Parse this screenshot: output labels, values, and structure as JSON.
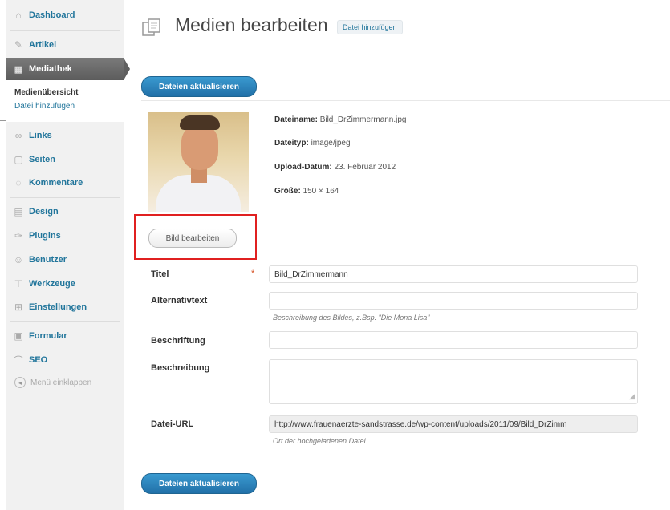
{
  "sidebar": {
    "items": [
      {
        "label": "Dashboard",
        "icon": "dashboard-icon",
        "glyph": "⌂"
      },
      {
        "label": "Artikel",
        "icon": "pin-icon",
        "glyph": "✎"
      },
      {
        "label": "Mediathek",
        "icon": "media-icon",
        "glyph": "▦"
      },
      {
        "label": "Links",
        "icon": "link-icon",
        "glyph": "∞"
      },
      {
        "label": "Seiten",
        "icon": "page-icon",
        "glyph": "▢"
      },
      {
        "label": "Kommentare",
        "icon": "comment-icon",
        "glyph": "◌"
      },
      {
        "label": "Design",
        "icon": "design-icon",
        "glyph": "▤"
      },
      {
        "label": "Plugins",
        "icon": "plugin-icon",
        "glyph": "✑"
      },
      {
        "label": "Benutzer",
        "icon": "users-icon",
        "glyph": "☺"
      },
      {
        "label": "Werkzeuge",
        "icon": "tools-icon",
        "glyph": "⊤"
      },
      {
        "label": "Einstellungen",
        "icon": "settings-icon",
        "glyph": "⊞"
      },
      {
        "label": "Formular",
        "icon": "form-icon",
        "glyph": "▣"
      },
      {
        "label": "SEO",
        "icon": "seo-icon",
        "glyph": "⌒"
      }
    ],
    "submenu": {
      "current": "Medienübersicht",
      "link": "Datei hinzufügen"
    },
    "collapse_label": "Menü einklappen"
  },
  "header": {
    "title": "Medien bearbeiten",
    "add_new": "Datei hinzufügen"
  },
  "buttons": {
    "update_top": "Dateien aktualisieren",
    "update_bottom": "Dateien aktualisieren",
    "edit_image": "Bild bearbeiten"
  },
  "file_info": {
    "filename_label": "Dateiname:",
    "filename": "Bild_DrZimmermann.jpg",
    "type_label": "Dateityp:",
    "type": "image/jpeg",
    "date_label": "Upload-Datum:",
    "date": "23. Februar 2012",
    "size_label": "Größe:",
    "size": "150 × 164"
  },
  "form": {
    "title_label": "Titel",
    "title_value": "Bild_DrZimmermann",
    "required_mark": "*",
    "alt_label": "Alternativtext",
    "alt_value": "",
    "alt_hint": "Beschreibung des Bildes, z.Bsp. \"Die Mona Lisa\"",
    "caption_label": "Beschriftung",
    "caption_value": "",
    "description_label": "Beschreibung",
    "description_value": "",
    "url_label": "Datei-URL",
    "url_value": "http://www.frauenaerzte-sandstrasse.de/wp-content/uploads/2011/09/Bild_DrZimm",
    "url_hint": "Ort der hochgeladenen Datei."
  },
  "colors": {
    "highlight": "#e02020",
    "accent": "#21759b",
    "button": "#2170a8"
  }
}
